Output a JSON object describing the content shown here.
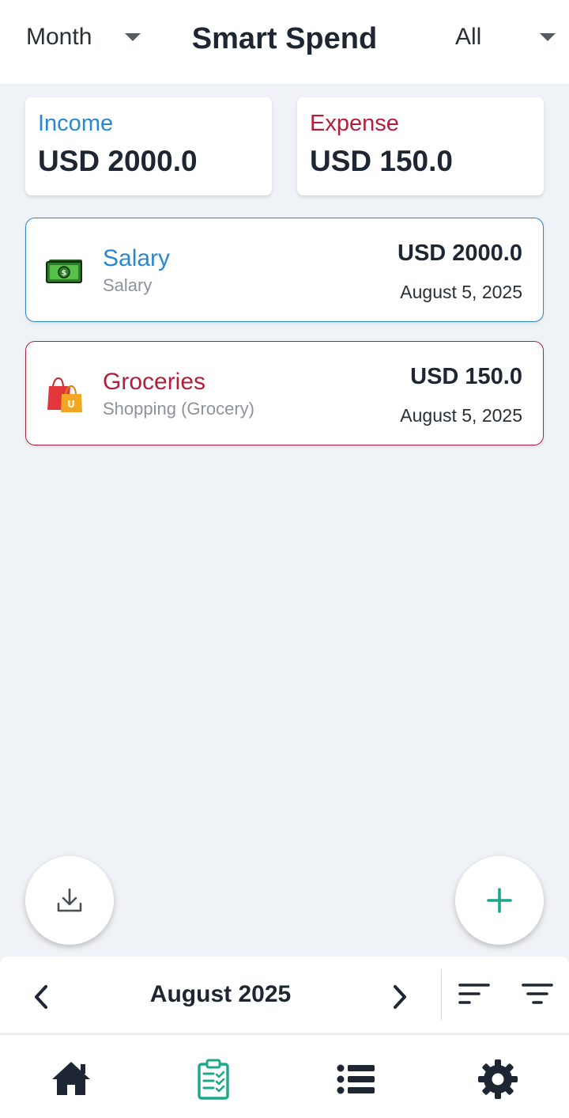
{
  "header": {
    "period_dropdown": "Month",
    "title": "Smart Spend",
    "filter_dropdown": "All"
  },
  "summary": {
    "income": {
      "label": "Income",
      "value": "USD 2000.0",
      "color": "#2a88cf"
    },
    "expense": {
      "label": "Expense",
      "value": "USD 150.0",
      "color": "#b21f3a"
    }
  },
  "transactions": [
    {
      "name": "Salary",
      "category": "Salary",
      "amount": "USD 2000.0",
      "date": "August 5, 2025",
      "icon": "money-icon",
      "type": "income"
    },
    {
      "name": "Groceries",
      "category": "Shopping (Grocery)",
      "amount": "USD 150.0",
      "date": "August 5, 2025",
      "icon": "shopping-bag-icon",
      "type": "expense"
    }
  ],
  "fab": {
    "download_icon": "download-icon",
    "add_icon": "plus-icon",
    "accent": "#1aa889"
  },
  "period_bar": {
    "label": "August 2025",
    "prev_icon": "chevron-left-icon",
    "next_icon": "chevron-right-icon",
    "sort_icon": "sort-icon",
    "filter_icon": "filter-icon"
  },
  "bottom_nav": {
    "items": [
      "home-icon",
      "clipboard-icon",
      "list-icon",
      "gear-icon"
    ],
    "active": "clipboard-icon",
    "active_color": "#1aa889",
    "inactive_color": "#1f2633"
  }
}
